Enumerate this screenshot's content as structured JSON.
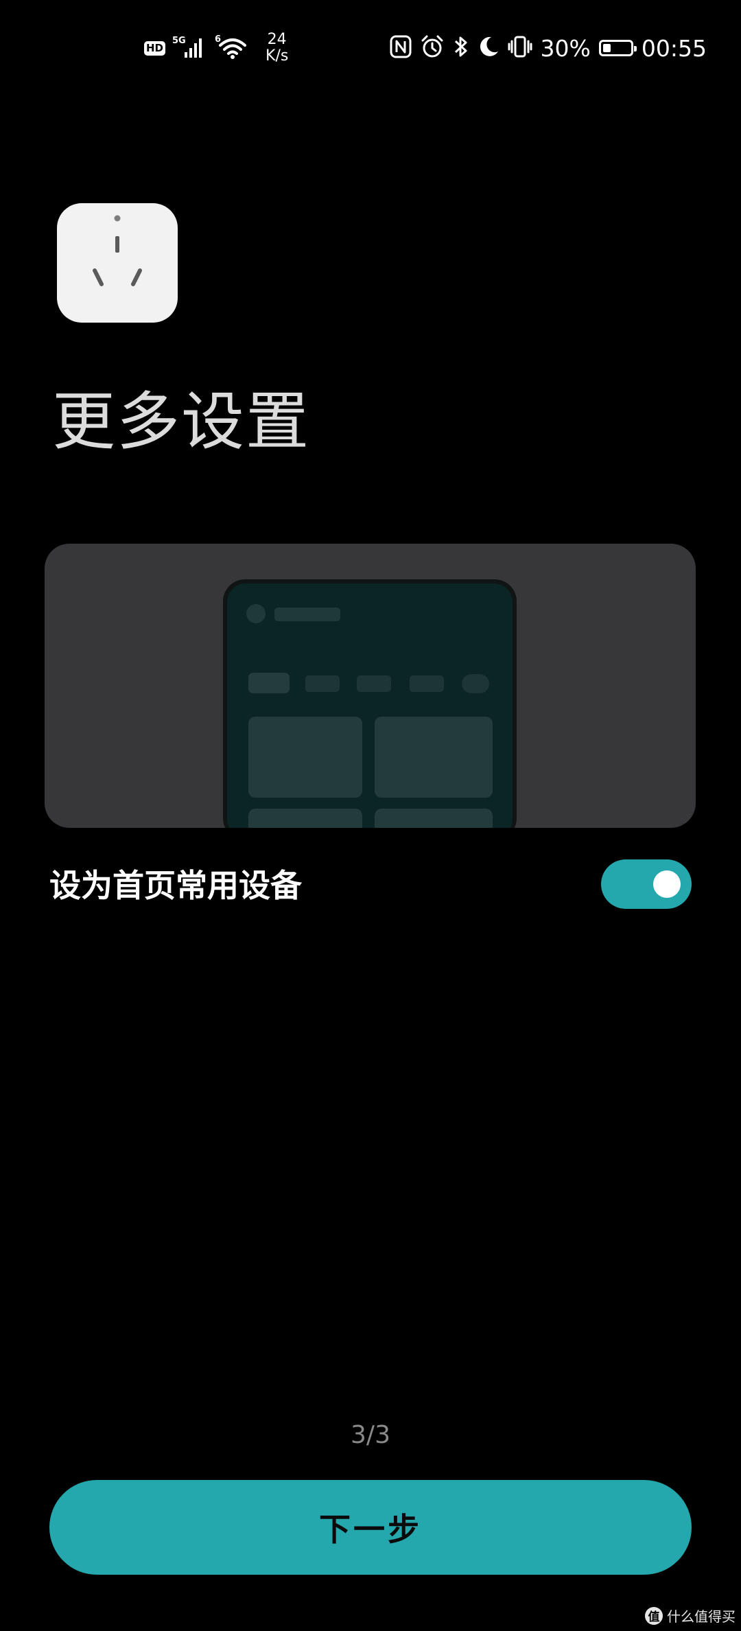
{
  "status_bar": {
    "hd_label": "HD",
    "network_label": "5G",
    "wifi_label": "6",
    "speed_value": "24",
    "speed_unit": "K/s",
    "battery_percent": "30%",
    "battery_level": 0.3,
    "time": "00:55",
    "icons": [
      "nfc-icon",
      "alarm-icon",
      "bluetooth-icon",
      "moon-icon",
      "vibrate-icon",
      "battery-icon"
    ]
  },
  "device": {
    "icon": "power-socket-icon"
  },
  "title": "更多设置",
  "setting": {
    "label": "设为首页常用设备",
    "enabled": true
  },
  "colors": {
    "accent": "#24a8ad",
    "background": "#000000",
    "card": "#37373a"
  },
  "pagination": "3/3",
  "next_button_label": "下一步",
  "watermark": {
    "badge": "值",
    "text": "什么值得买"
  }
}
